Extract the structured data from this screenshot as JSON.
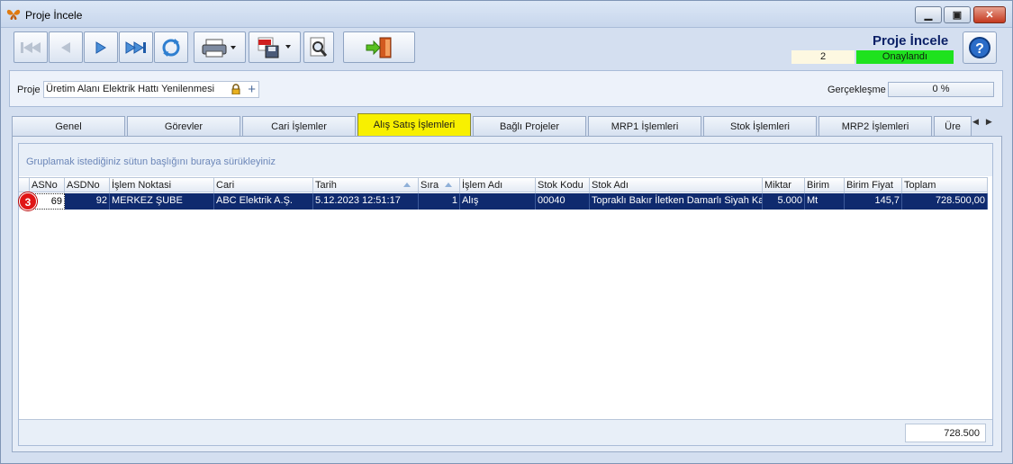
{
  "window": {
    "title": "Proje İncele"
  },
  "header": {
    "title": "Proje İncele",
    "record_no": "2",
    "status": "Onaylandı"
  },
  "project": {
    "label": "Proje",
    "value": "Üretim Alanı Elektrik Hattı Yenilenmesi",
    "realization_label": "Gerçekleşme",
    "realization_value": "0 %"
  },
  "tabs": [
    {
      "label": "Genel"
    },
    {
      "label": "Görevler"
    },
    {
      "label": "Cari İşlemler"
    },
    {
      "label": "Alış Satış İşlemleri"
    },
    {
      "label": "Bağlı Projeler"
    },
    {
      "label": "MRP1 İşlemleri"
    },
    {
      "label": "Stok İşlemleri"
    },
    {
      "label": "MRP2 İşlemleri"
    },
    {
      "label": "Üre"
    }
  ],
  "grid": {
    "group_hint": "Gruplamak istediğiniz sütun başlığını buraya sürükleyiniz",
    "columns": [
      "ASNo",
      "ASDNo",
      "İşlem Noktasi",
      "Cari",
      "Tarih",
      "Sıra",
      "İşlem Adı",
      "Stok Kodu",
      "Stok Adı",
      "Miktar",
      "Birim",
      "Birim Fiyat",
      "Toplam"
    ],
    "rows": [
      [
        "69",
        "92",
        "MERKEZ ŞUBE",
        "ABC Elektrik A.Ş.",
        "5.12.2023 12:51:17",
        "1",
        "Alış",
        "00040",
        "Topraklı Bakır İletken Damarlı Siyah Kabl",
        "5.000",
        "Mt",
        "145,7",
        "728.500,00"
      ]
    ],
    "badge": "3",
    "footer_total": "728.500"
  },
  "colors": {
    "active_tab": "#f8f000",
    "status_green": "#1ee21e",
    "selected_row": "#0f2a6e",
    "badge_red": "#e01515"
  }
}
